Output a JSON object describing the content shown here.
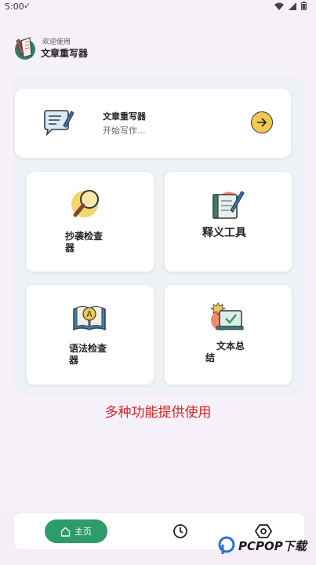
{
  "status_bar": {
    "time": "5:00",
    "check": "✓"
  },
  "header": {
    "welcome": "欢迎使用",
    "title": "文章重写器"
  },
  "hero": {
    "title": "文章重写器",
    "subtitle": "开始写作..."
  },
  "tiles": [
    {
      "label": "抄袭检查\n器"
    },
    {
      "label": "释义工具"
    },
    {
      "label": "语法检查\n器"
    },
    {
      "label": "文本总\n结"
    }
  ],
  "promo_text": "多种功能提供使用",
  "bottom_nav": {
    "home_label": "主页"
  },
  "watermark": {
    "text": "PCPOP下载"
  },
  "colors": {
    "accent_green": "#2d9c6a",
    "promo_red": "#d8262a",
    "arrow_yellow": "#f3c94f"
  }
}
